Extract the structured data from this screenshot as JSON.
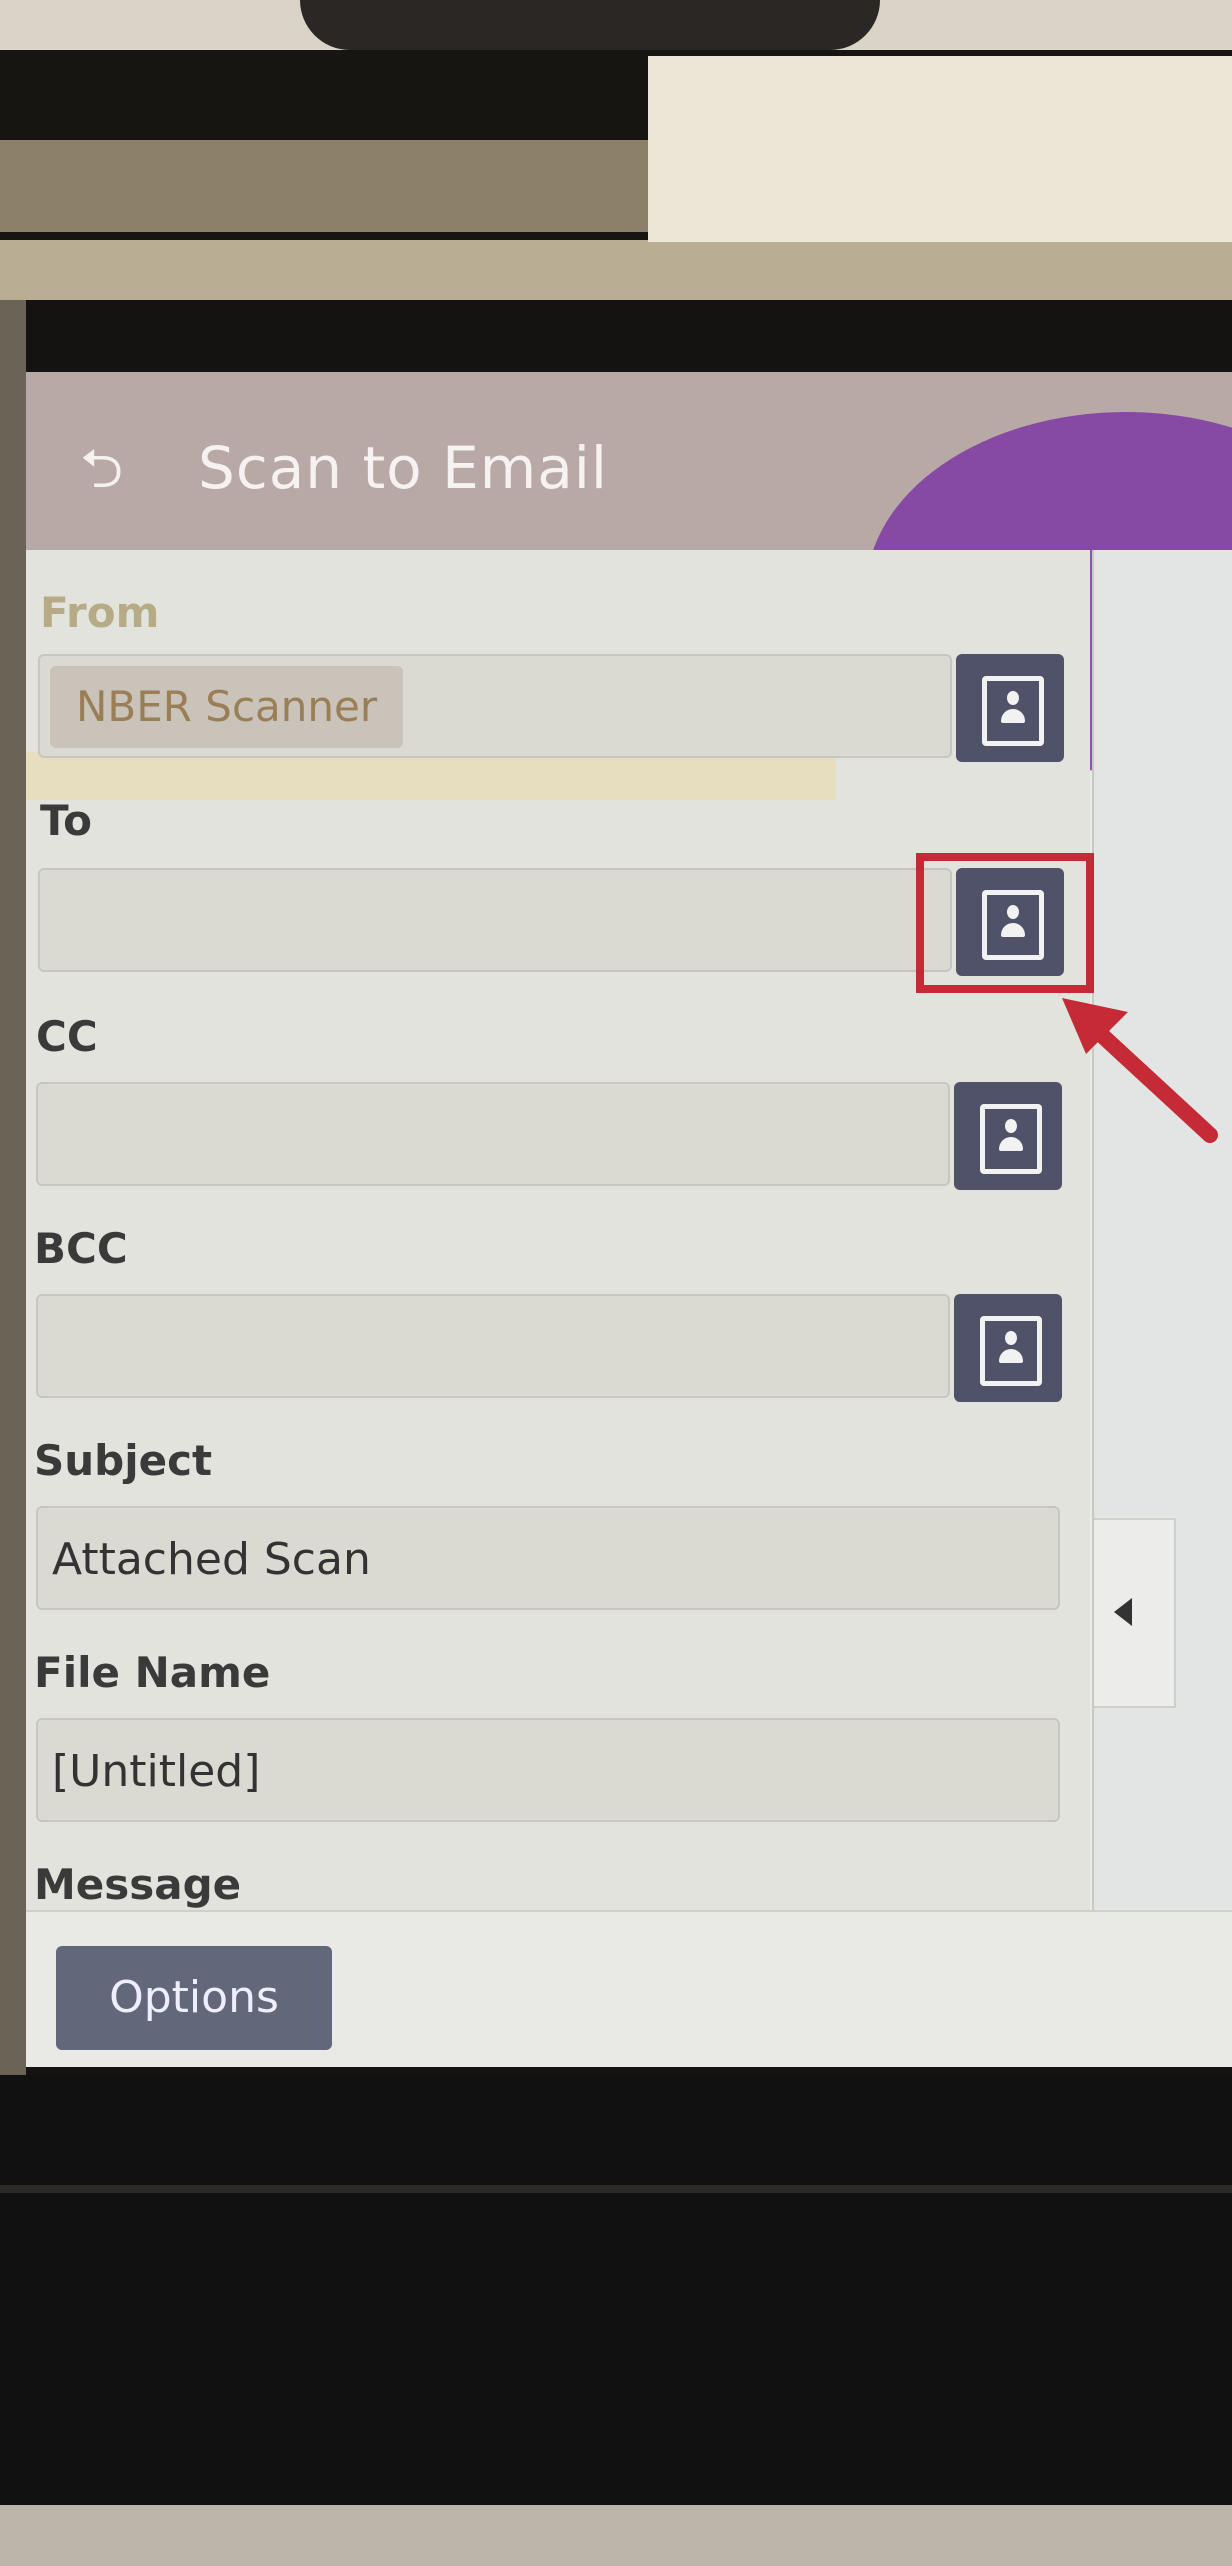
{
  "screen": {
    "title": "Scan to Email"
  },
  "form": {
    "from": {
      "label": "From",
      "value": "NBER Scanner"
    },
    "to": {
      "label": "To",
      "value": ""
    },
    "cc": {
      "label": "CC",
      "value": ""
    },
    "bcc": {
      "label": "BCC",
      "value": ""
    },
    "subject": {
      "label": "Subject",
      "value": "Attached Scan"
    },
    "file_name": {
      "label": "File Name",
      "value": "[Untitled]"
    },
    "message": {
      "label": "Message"
    }
  },
  "bottom": {
    "options_label": "Options"
  },
  "colors": {
    "highlight": "#c42b36",
    "button": "#4f5268",
    "header": "#b9a9a6"
  },
  "icons": [
    "back-icon",
    "address-book-icon",
    "collapse-arrow-icon"
  ]
}
